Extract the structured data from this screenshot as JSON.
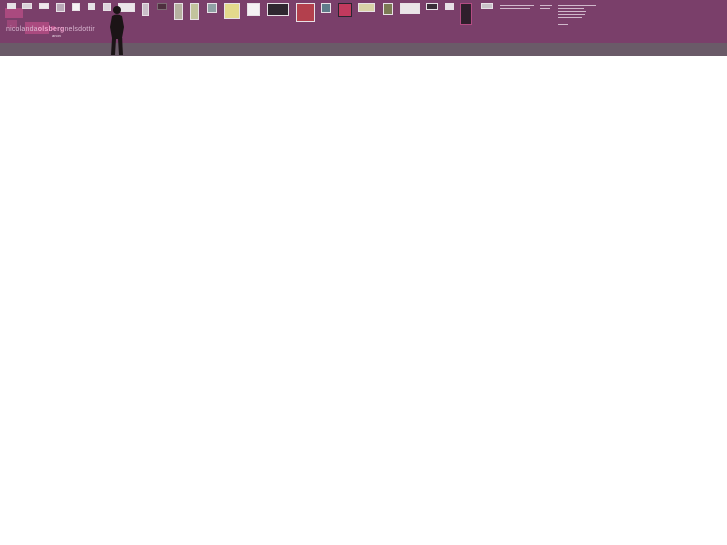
{
  "site": {
    "wordmark": {
      "part1": "nicolanda",
      "part2": "olsberg",
      "part3": "nelsdottir",
      "sub": "anon"
    }
  },
  "colors": {
    "wall": "#7a3f6a",
    "floor": "#6a5a68",
    "accent": "#b34c83"
  },
  "menu": {
    "items": [
      "",
      "",
      "",
      "",
      ""
    ]
  },
  "gallery": {
    "artworks": [
      "artwork-1",
      "artwork-2",
      "artwork-3",
      "artwork-4",
      "artwork-5",
      "artwork-6",
      "artwork-7",
      "artwork-8",
      "artwork-9",
      "artwork-10",
      "artwork-11",
      "artwork-12",
      "artwork-13",
      "artwork-14",
      "artwork-15",
      "artwork-16",
      "artwork-17",
      "artwork-18",
      "artwork-19",
      "artwork-20",
      "artwork-21",
      "artwork-22",
      "artwork-23",
      "artwork-24",
      "artwork-25",
      "artwork-26"
    ]
  },
  "icons": {
    "visitor": "person-silhouette-icon"
  }
}
